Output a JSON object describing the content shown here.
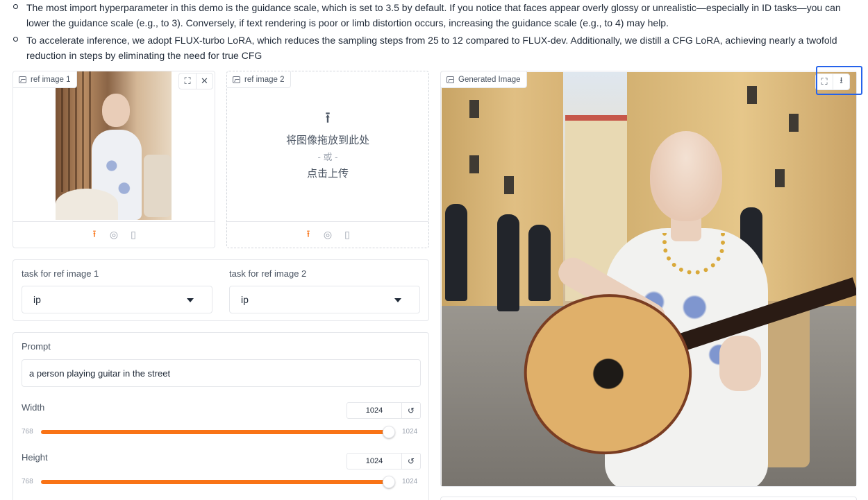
{
  "notes": [
    "The most import hyperparameter in this demo is the guidance scale, which is set to 3.5 by default. If you notice that faces appear overly glossy or unrealistic—especially in ID tasks—you can lower the guidance scale (e.g., to 3). Conversely, if text rendering is poor or limb distortion occurs, increasing the guidance scale (e.g., to 4) may help.",
    "To accelerate inference, we adopt FLUX-turbo LoRA, which reduces the sampling steps from 25 to 12 compared to FLUX-dev. Additionally, we distill a CFG LoRA, achieving nearly a twofold reduction in steps by eliminating the need for true CFG"
  ],
  "ref1": {
    "label": "ref image 1"
  },
  "ref2": {
    "label": "ref image 2",
    "drop_text": "将图像拖放到此处",
    "or_text": "- 或 -",
    "upload_text": "点击上传"
  },
  "tasks": {
    "task1_label": "task for ref image 1",
    "task1_value": "ip",
    "task2_label": "task for ref image 2",
    "task2_value": "ip"
  },
  "prompt": {
    "label": "Prompt",
    "value": "a person playing guitar in the street"
  },
  "width": {
    "label": "Width",
    "value": "1024",
    "min": "768",
    "max": "1024",
    "fraction": 1.0
  },
  "height": {
    "label": "Height",
    "value": "1024",
    "min": "768",
    "max": "1024",
    "fraction": 1.0
  },
  "output": {
    "label": "Generated Image"
  },
  "icons": {
    "fullscreen": "fullscreen-icon",
    "close": "close-icon",
    "download": "download-icon",
    "upload": "upload-icon",
    "webcam": "webcam-icon",
    "clipboard": "clipboard-icon",
    "image": "image-icon",
    "reset": "reset-icon",
    "dropdown": "chevron-down-icon"
  },
  "colors": {
    "accent": "#f97316",
    "selection": "#2563eb"
  }
}
